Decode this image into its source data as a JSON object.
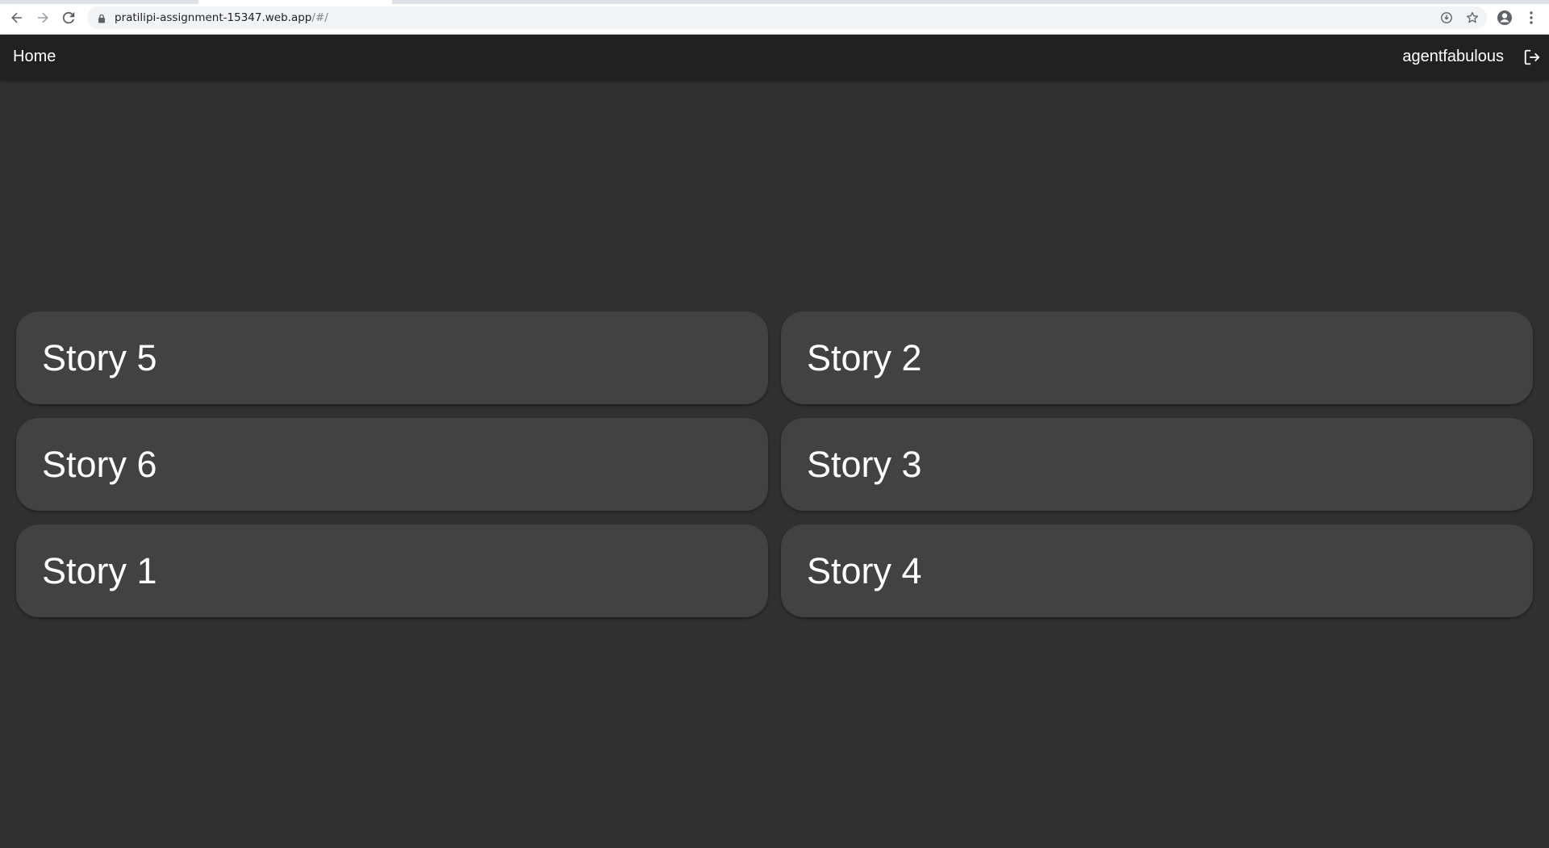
{
  "browser": {
    "url_host": "pratilipi-assignment-15347.web.app",
    "url_path": "/#/",
    "icons": [
      "back-icon",
      "forward-icon",
      "reload-icon",
      "lock-icon",
      "install-icon",
      "star-icon",
      "profile-icon",
      "menu-icon"
    ]
  },
  "appbar": {
    "home_label": "Home",
    "username": "agentfabulous",
    "logout_icon": "logout-icon"
  },
  "stories": [
    {
      "title": "Story 5"
    },
    {
      "title": "Story 2"
    },
    {
      "title": "Story 6"
    },
    {
      "title": "Story 3"
    },
    {
      "title": "Story 1"
    },
    {
      "title": "Story 4"
    }
  ],
  "colors": {
    "page_bg": "#303030",
    "appbar_bg": "#212121",
    "card_bg": "#424242",
    "text": "#ffffff"
  }
}
